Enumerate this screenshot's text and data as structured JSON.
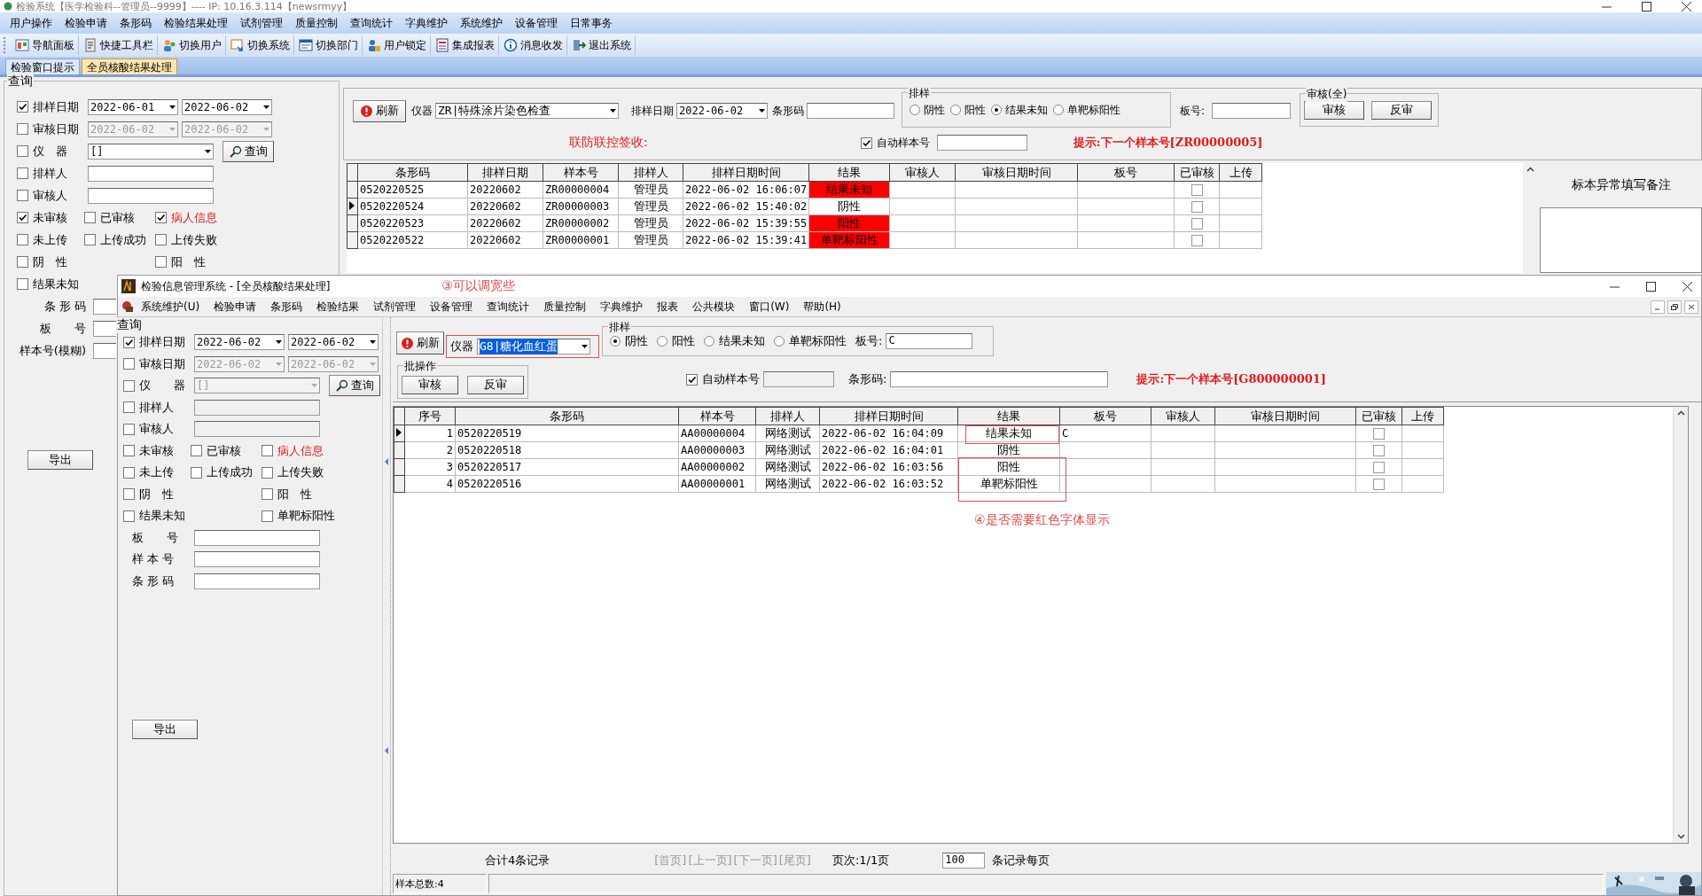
{
  "main_window": {
    "title": "检验系统【医学检验科--管理员--9999】---- IP: 10.16.3.114【newsrmyy】",
    "menu": [
      "用户操作",
      "检验申请",
      "条形码",
      "检验结果处理",
      "试剂管理",
      "质量控制",
      "查询统计",
      "字典维护",
      "系统维护",
      "设备管理",
      "日常事务"
    ],
    "toolbar": [
      "导航面板",
      "快捷工具栏",
      "切换用户",
      "切换系统",
      "切换部门",
      "用户锁定",
      "集成报表",
      "消息收发",
      "退出系统"
    ],
    "tabs": [
      {
        "label": "检验窗口提示",
        "selected": false
      },
      {
        "label": "全员核酸结果处理",
        "selected": true
      }
    ],
    "query": {
      "title": "查询",
      "search_button": "查询",
      "export_button": "导出",
      "rows": [
        {
          "kind": "date",
          "label": "排样日期",
          "checked": true,
          "from": "2022-06-01",
          "to": "2022-06-02",
          "disabled": false
        },
        {
          "kind": "date",
          "label": "审核日期",
          "checked": false,
          "from": "2022-06-02",
          "to": "2022-06-02",
          "disabled": true
        },
        {
          "kind": "combo",
          "label": "仪　器",
          "checked": false,
          "value": "[]",
          "disabled": false
        },
        {
          "kind": "text",
          "label": "排样人",
          "checked": false,
          "disabled": false
        },
        {
          "kind": "text",
          "label": "审核人",
          "checked": false,
          "disabled": false
        }
      ],
      "filters": [
        [
          {
            "label": "未审核",
            "checked": true,
            "emphasized": false
          },
          {
            "label": "已审核",
            "checked": false,
            "emphasized": false
          },
          {
            "label": "病人信息",
            "checked": true,
            "emphasized": true
          }
        ],
        [
          {
            "label": "未上传",
            "checked": false,
            "emphasized": false
          },
          {
            "label": "上传成功",
            "checked": false,
            "emphasized": false
          },
          {
            "label": "上传失败",
            "checked": false,
            "emphasized": false
          }
        ],
        [
          {
            "label": "阴　性",
            "checked": false,
            "emphasized": false
          },
          {
            "label": "阳　性",
            "checked": false,
            "emphasized": false
          }
        ],
        [
          {
            "label": "结果未知",
            "checked": false,
            "emphasized": false
          }
        ]
      ],
      "fields": [
        {
          "label": "条 形 码"
        },
        {
          "label": "板　　号"
        },
        {
          "label": "样本号(模糊)"
        }
      ]
    },
    "controls": {
      "refresh": "刷新",
      "instrument_label": "仪器",
      "instrument": "ZR|特殊涂片染色检查",
      "instrument_highlighted": false,
      "date_label": "排样日期",
      "date": "2022-06-02",
      "barcode_label": "条形码",
      "sort": {
        "title": "排样",
        "options": [
          {
            "label": "阴性",
            "selected": false
          },
          {
            "label": "阳性",
            "selected": false
          },
          {
            "label": "结果未知",
            "selected": true
          },
          {
            "label": "单靶标阳性",
            "selected": false
          }
        ]
      },
      "plate_label": "板号:",
      "audit": {
        "title": "审核(全)",
        "buttons": [
          "审核",
          "反审"
        ]
      },
      "notice": "联防联控签收:",
      "auto_sample": {
        "label": "自动样本号",
        "checked": true
      },
      "hint": "提示:下一个样本号[ZR00000005]"
    },
    "grid": {
      "columns": [
        {
          "label": "条形码",
          "kind": "text"
        },
        {
          "label": "排样日期",
          "kind": "text"
        },
        {
          "label": "样本号",
          "kind": "text"
        },
        {
          "label": "排样人",
          "kind": "center"
        },
        {
          "label": "排样日期时间",
          "kind": "text"
        },
        {
          "label": "结果",
          "kind": "result"
        },
        {
          "label": "审核人",
          "kind": "text"
        },
        {
          "label": "审核日期时间",
          "kind": "text"
        },
        {
          "label": "板号",
          "kind": "text"
        },
        {
          "label": "已审核",
          "kind": "check"
        },
        {
          "label": "上传",
          "kind": "text"
        }
      ],
      "rows": [
        {
          "selected": false,
          "flagged": true,
          "cells": [
            "0520220525",
            "20220602",
            "ZR00000004",
            "管理员",
            "2022-06-02 16:06:07",
            "结果未知",
            null,
            null,
            null,
            false,
            null
          ]
        },
        {
          "selected": true,
          "flagged": false,
          "cells": [
            "0520220524",
            "20220602",
            "ZR00000003",
            "管理员",
            "2022-06-02 15:40:02",
            "阴性",
            null,
            null,
            null,
            false,
            null
          ]
        },
        {
          "selected": false,
          "flagged": true,
          "cells": [
            "0520220523",
            "20220602",
            "ZR00000002",
            "管理员",
            "2022-06-02 15:39:55",
            "阳性",
            null,
            null,
            null,
            false,
            null
          ]
        },
        {
          "selected": false,
          "flagged": true,
          "cells": [
            "0520220522",
            "20220602",
            "ZR00000001",
            "管理员",
            "2022-06-02 15:39:41",
            "单靶标阳性",
            null,
            null,
            null,
            false,
            null
          ]
        }
      ]
    },
    "remark_title": "标本异常填写备注"
  },
  "child_window": {
    "title": "检验信息管理系统 - [全员核酸结果处理]",
    "annotation_title": "③可以调宽些",
    "annotation_grid": "④是否需要红色字体显示",
    "menu": [
      "系统维护(U)",
      "检验申请",
      "条形码",
      "检验结果",
      "试剂管理",
      "设备管理",
      "查询统计",
      "质量控制",
      "字典维护",
      "报表",
      "公共模块",
      "窗口(W)",
      "帮助(H)"
    ],
    "query": {
      "title": "查询",
      "search_button": "查询",
      "export_button": "导出",
      "rows": [
        {
          "kind": "date",
          "label": "排样日期",
          "checked": true,
          "from": "2022-06-02",
          "to": "2022-06-02",
          "disabled": false
        },
        {
          "kind": "date",
          "label": "审核日期",
          "checked": false,
          "from": "2022-06-02",
          "to": "2022-06-02",
          "disabled": true
        },
        {
          "kind": "combo",
          "label": "仪　　器",
          "checked": false,
          "value": "[]",
          "disabled": true
        },
        {
          "kind": "text",
          "label": "排样人",
          "checked": false,
          "disabled": true
        },
        {
          "kind": "text",
          "label": "审核人",
          "checked": false,
          "disabled": true
        }
      ],
      "filters": [
        [
          {
            "label": "未审核",
            "checked": false,
            "emphasized": false
          },
          {
            "label": "已审核",
            "checked": false,
            "emphasized": false
          },
          {
            "label": "病人信息",
            "checked": false,
            "emphasized": true
          }
        ],
        [
          {
            "label": "未上传",
            "checked": false,
            "emphasized": false
          },
          {
            "label": "上传成功",
            "checked": false,
            "emphasized": false
          },
          {
            "label": "上传失败",
            "checked": false,
            "emphasized": false
          }
        ],
        [
          {
            "label": "阴　性",
            "checked": false,
            "emphasized": false
          },
          {
            "label": "阳　性",
            "checked": false,
            "emphasized": false
          }
        ],
        [
          {
            "label": "结果未知",
            "checked": false,
            "emphasized": false
          },
          {
            "label": "单靶标阳性",
            "checked": false,
            "emphasized": false
          }
        ]
      ],
      "fields": [
        {
          "label": "板　　号"
        },
        {
          "label": "样 本 号"
        },
        {
          "label": "条 形 码"
        }
      ]
    },
    "controls": {
      "refresh": "刷新",
      "instrument_label": "仪器",
      "instrument": "G8|糖化血红蛋",
      "instrument_highlighted": true,
      "sort": {
        "title": "排样",
        "options": [
          {
            "label": "阴性",
            "selected": true
          },
          {
            "label": "阳性",
            "selected": false
          },
          {
            "label": "结果未知",
            "selected": false
          },
          {
            "label": "单靶标阳性",
            "selected": false
          }
        ]
      },
      "plate_label": "板号:",
      "plate": "C",
      "batch": {
        "title": "批操作",
        "buttons": [
          "审核",
          "反审"
        ]
      },
      "auto_sample": {
        "label": "自动样本号",
        "checked": true
      },
      "barcode_label": "条形码:",
      "hint": "提示:下一个样本号[G800000001]"
    },
    "grid": {
      "columns": [
        {
          "label": "序号",
          "kind": "num"
        },
        {
          "label": "条形码",
          "kind": "text"
        },
        {
          "label": "样本号",
          "kind": "text"
        },
        {
          "label": "排样人",
          "kind": "center"
        },
        {
          "label": "排样日期时间",
          "kind": "text"
        },
        {
          "label": "结果",
          "kind": "result"
        },
        {
          "label": "板号",
          "kind": "text"
        },
        {
          "label": "审核人",
          "kind": "text"
        },
        {
          "label": "审核日期时间",
          "kind": "text"
        },
        {
          "label": "已审核",
          "kind": "check"
        },
        {
          "label": "上传",
          "kind": "text"
        }
      ],
      "rows": [
        {
          "selected": true,
          "flagged": false,
          "cells": [
            "1",
            "0520220519",
            "AA00000004",
            "网络测试",
            "2022-06-02 16:04:09",
            "结果未知",
            "C",
            null,
            null,
            false,
            null
          ]
        },
        {
          "selected": false,
          "flagged": false,
          "cells": [
            "2",
            "0520220518",
            "AA00000003",
            "网络测试",
            "2022-06-02 16:04:01",
            "阴性",
            null,
            null,
            null,
            false,
            null
          ]
        },
        {
          "selected": false,
          "flagged": false,
          "cells": [
            "3",
            "0520220517",
            "AA00000002",
            "网络测试",
            "2022-06-02 16:03:56",
            "阳性",
            null,
            null,
            null,
            false,
            null
          ]
        },
        {
          "selected": false,
          "flagged": false,
          "cells": [
            "4",
            "0520220516",
            "AA00000001",
            "网络测试",
            "2022-06-02 16:03:52",
            "单靶标阳性",
            null,
            null,
            null,
            false,
            null
          ]
        }
      ]
    },
    "footer": {
      "total": "合计4条记录",
      "pager": [
        {
          "label": "[首页]",
          "disabled": true
        },
        {
          "label": "[上一页]",
          "disabled": true
        },
        {
          "label": "[下一页]",
          "disabled": true
        },
        {
          "label": "[尾页]",
          "disabled": true
        }
      ],
      "page": "页次:1/1页",
      "page_size": "100",
      "page_size_label": "条记录每页"
    },
    "status": "样本总数:4"
  }
}
